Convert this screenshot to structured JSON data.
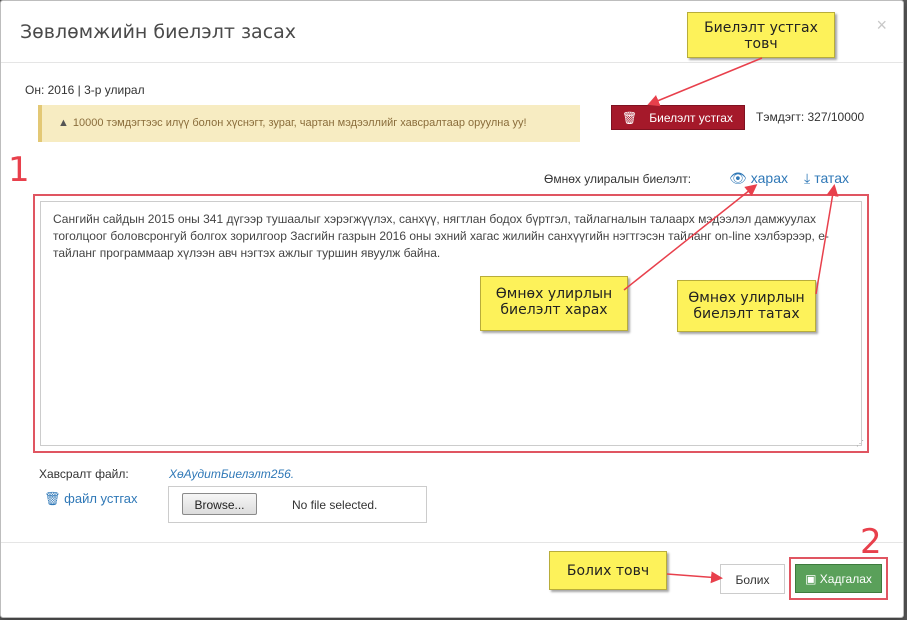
{
  "modal": {
    "title": "Зөвлөмжийн биелэлт засах",
    "close_label": "×"
  },
  "info": {
    "year_quarter": "Он: 2016 | 3-р улирал"
  },
  "warning": {
    "text": "10000 тэмдэгтээс илүү болон хүснэгт, зураг, чартан мэдээллийг хавсралтаар оруулна уу!"
  },
  "actions": {
    "remove_label": "Биелэлт устгах",
    "char_count": "Тэмдэгт: 327/10000"
  },
  "previous": {
    "label": "Өмнөх улиралын биелэлт:",
    "view_label": "харах",
    "download_label": "татах"
  },
  "editor": {
    "text": "Сангийн сайдын 2015 оны 341 дүгээр тушаалыг хэрэгжүүлэх, санхүү, нягтлан бодох бүртгэл, тайлагналын талаарх мэдээлэл дамжуулах тоголцоог боловсронгуй болгох зорилгоор Засгийн газрын 2016 оны эхний хагас жилийн  санхүүгийн нэгтгэсэн тайланг on-line хэлбэрээр, е-тайланг программаар хүлээн авч нэгтэх ажлыг туршин явуулж байна."
  },
  "attachment": {
    "label": "Хавсралт файл:",
    "file_name": "ХөАудитБиелэлт256.",
    "remove_label": "файл устгах",
    "browse_label": "Browse...",
    "status": "No file selected."
  },
  "footer": {
    "cancel_label": "Болих",
    "save_label": "Хадгалах"
  },
  "annotations": {
    "callout_remove_line1": "Биелэлт устгах",
    "callout_remove_line2": "товч",
    "callout_view_line1": "Өмнөх улирлын",
    "callout_view_line2": "биелэлт харах",
    "callout_download_line1": "Өмнөх улирлын",
    "callout_download_line2": "биелэлт татах",
    "callout_cancel": "Болих товч",
    "number_1": "1",
    "number_2": "2"
  },
  "colors": {
    "danger": "#a5192a",
    "success": "#5aa05a",
    "link": "#2f78b7",
    "highlight": "#e05561",
    "callout": "#fdf25a"
  }
}
